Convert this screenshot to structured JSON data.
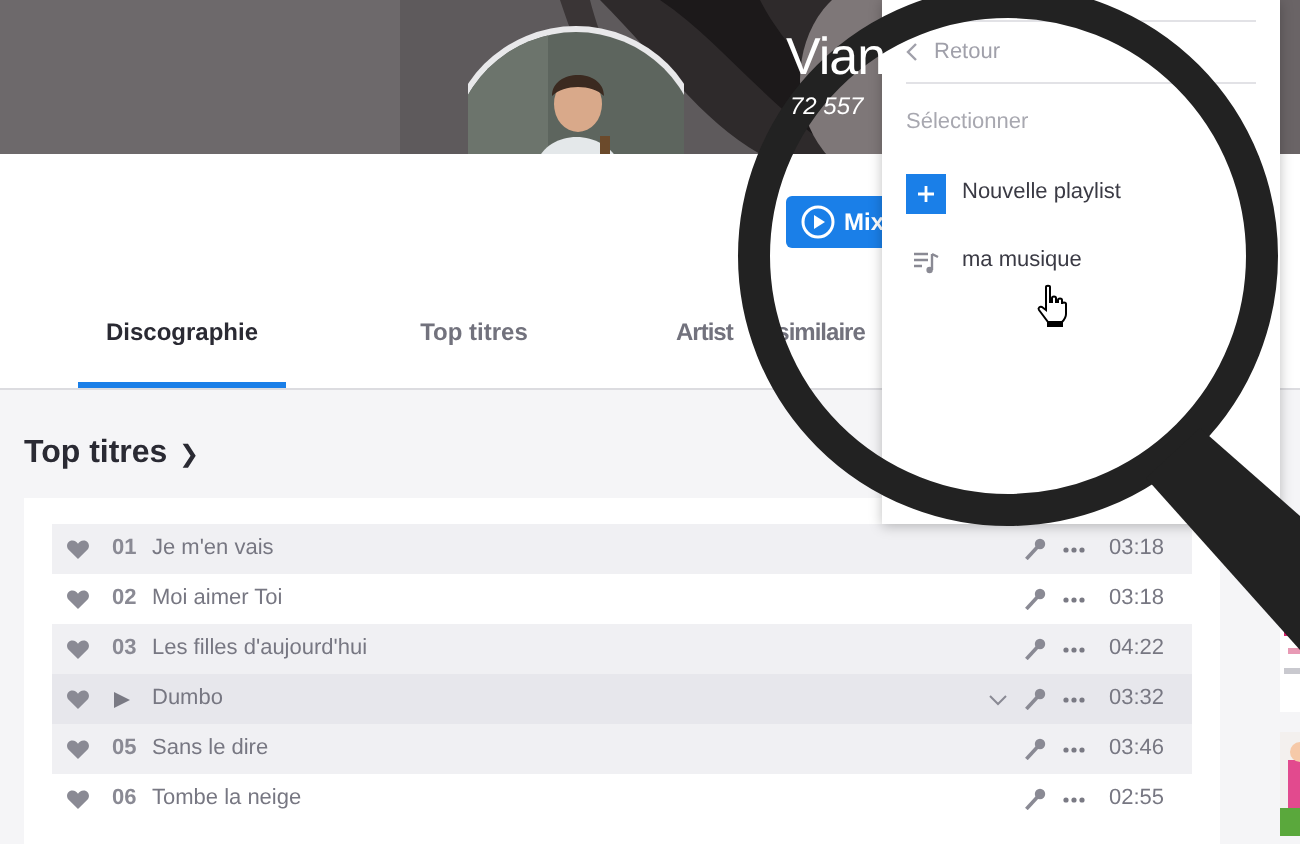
{
  "artist": {
    "name": "Vian",
    "followers": "72 557"
  },
  "mix_button": {
    "label": "Mix"
  },
  "tabs": [
    {
      "label": "Discographie",
      "selected": true
    },
    {
      "label": "Top titres",
      "selected": false
    },
    {
      "label": "Artist similaire",
      "selected": false
    }
  ],
  "section": {
    "title": "Top titres",
    "chevron": "❯"
  },
  "tracks": [
    {
      "number": "01",
      "title": "Je m'en vais",
      "duration": "03:18",
      "playing": false
    },
    {
      "number": "02",
      "title": "Moi aimer Toi",
      "duration": "03:18",
      "playing": false
    },
    {
      "number": "03",
      "title": "Les filles d'aujourd'hui",
      "duration": "04:22",
      "playing": false
    },
    {
      "title": "Dumbo",
      "duration": "03:32",
      "playing": true
    },
    {
      "number": "05",
      "title": "Sans le dire",
      "duration": "03:46",
      "playing": false
    },
    {
      "number": "06",
      "title": "Tombe la neige",
      "duration": "02:55",
      "playing": false
    }
  ],
  "menu": {
    "back": "Retour",
    "heading": "Sélectionner",
    "items": [
      {
        "kind": "new",
        "label": "Nouvelle playlist",
        "hovered": false
      },
      {
        "kind": "playlist",
        "label": "ma musique",
        "hovered": true
      }
    ]
  }
}
